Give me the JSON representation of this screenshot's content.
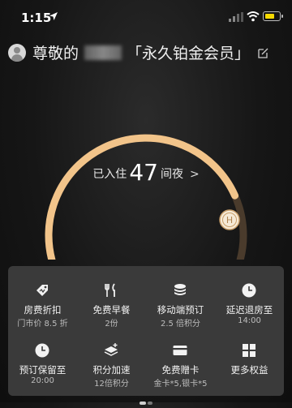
{
  "status": {
    "time": "1:15",
    "location_icon": "location-arrow-icon",
    "battery_color": "#f5d900"
  },
  "greeting": {
    "prefix": "尊敬的",
    "level": "「永久铂金会员」"
  },
  "gauge": {
    "stayed_label": "已入住",
    "nights": "47",
    "unit": "间夜",
    "arrow": ">",
    "progress": 0.8,
    "accent": "#f2c48a",
    "badge_letter": "H"
  },
  "benefits": [
    {
      "icon": "tag-icon",
      "title": "房费折扣",
      "sub": "门市价 8.5 折"
    },
    {
      "icon": "utensils-icon",
      "title": "免费早餐",
      "sub": "2份"
    },
    {
      "icon": "coin-stack-icon",
      "title": "移动端预订",
      "sub": "2.5 倍积分"
    },
    {
      "icon": "clock-icon",
      "title": "延迟退房至",
      "sub": "14:00"
    },
    {
      "icon": "clock-icon",
      "title": "预订保留至",
      "sub": "20:00"
    },
    {
      "icon": "stack-plus-icon",
      "title": "积分加速",
      "sub": "12倍积分"
    },
    {
      "icon": "card-icon",
      "title": "免费赠卡",
      "sub": "金卡*5,银卡*5"
    },
    {
      "icon": "grid-icon",
      "title": "更多权益",
      "sub": ""
    }
  ]
}
